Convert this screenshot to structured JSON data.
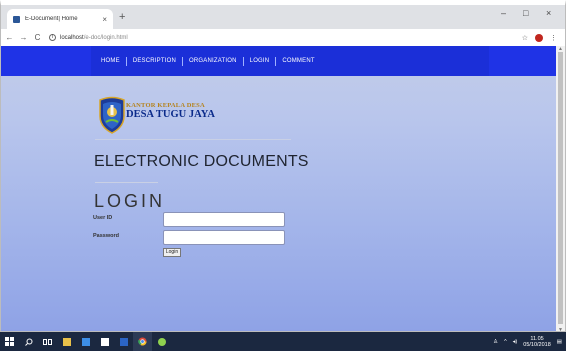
{
  "browser": {
    "tab_title": "E-Document| Home",
    "tab_close": "×",
    "new_tab": "+",
    "win_min": "–",
    "win_max": "□",
    "win_close": "×",
    "back": "←",
    "forward": "→",
    "reload": "C",
    "info": "i",
    "url_host": "localhost",
    "url_path": "/e-doc/login.html",
    "star": "☆",
    "menu": "⋮"
  },
  "nav": {
    "items": [
      "HOME",
      "DESCRIPTION",
      "ORGANIZATION",
      "LOGIN",
      "COMMENT"
    ]
  },
  "brand": {
    "line1": "KANTOR KEPALA DESA",
    "line2": "DESA TUGU JAYA"
  },
  "page": {
    "heading": "ELECTRONIC DOCUMENTS",
    "login_title": "LOGIN",
    "user_label": "User ID",
    "password_label": "Password",
    "login_button": "Login"
  },
  "taskbar": {
    "time": "11.05",
    "date": "05/10/2018"
  },
  "colors": {
    "nav_bar": "#1f33e6",
    "taskbar": "#1b2840"
  }
}
